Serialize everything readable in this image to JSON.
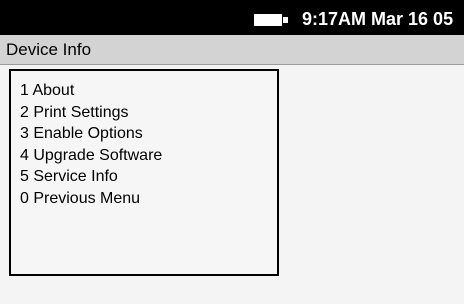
{
  "status_bar": {
    "battery_icon": "battery-icon",
    "time_date": "9:17AM Mar 16 05"
  },
  "header": {
    "title": "Device Info"
  },
  "menu": {
    "items": [
      {
        "label": "1 About"
      },
      {
        "label": "2 Print Settings"
      },
      {
        "label": "3 Enable Options"
      },
      {
        "label": "4 Upgrade Software"
      },
      {
        "label": "5 Service Info"
      },
      {
        "label": "0 Previous Menu"
      }
    ]
  },
  "colors": {
    "status_bar_bg": "#000000",
    "title_bar_bg": "#d3d3d3",
    "screen_bg": "#f4f4f4"
  }
}
